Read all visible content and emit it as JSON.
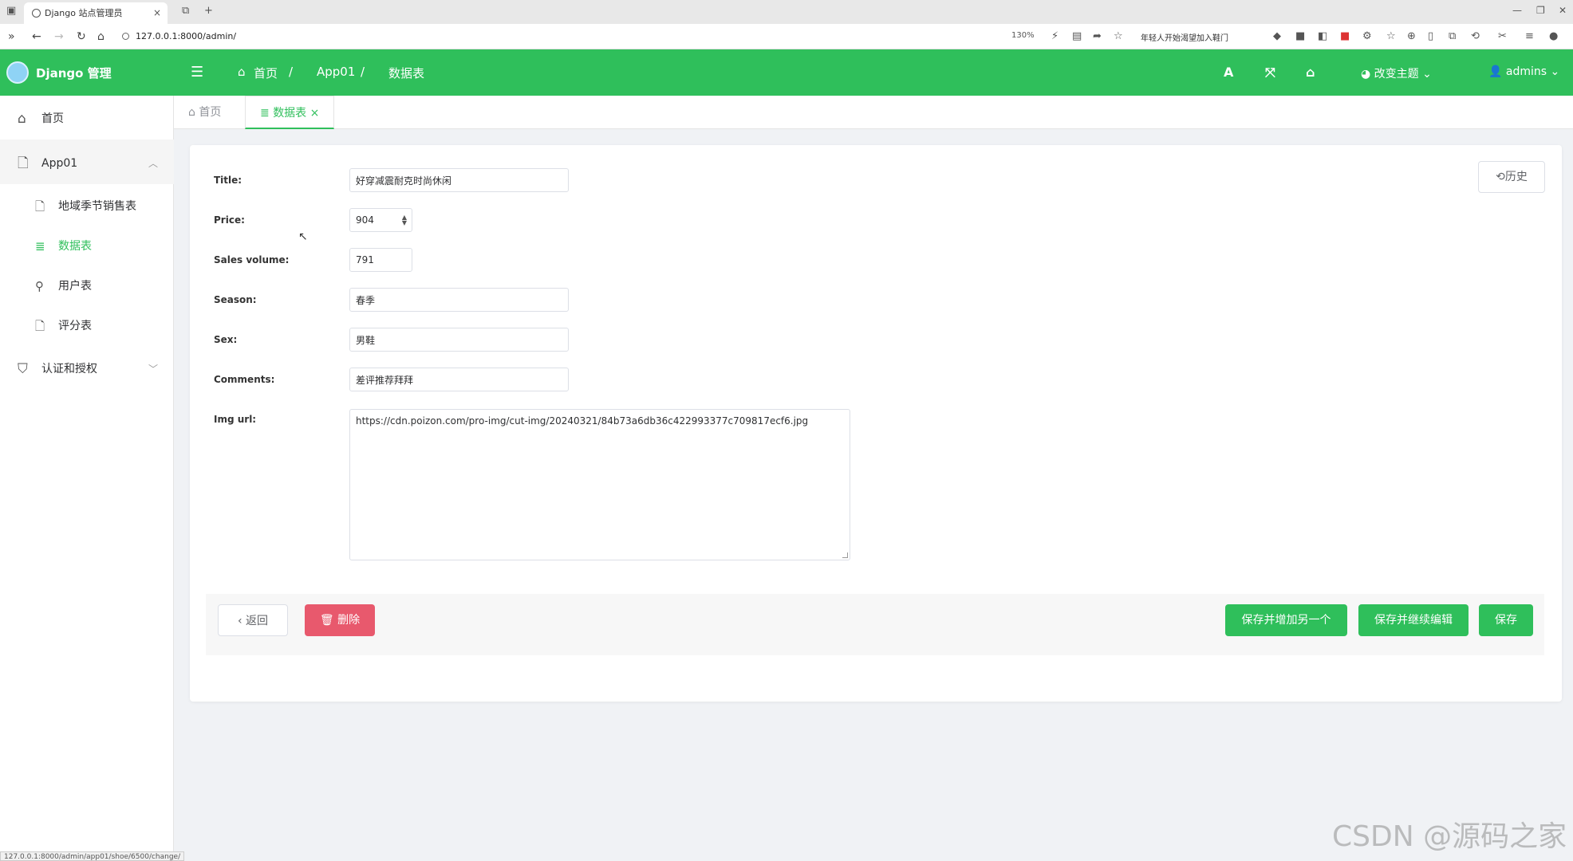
{
  "browser": {
    "tab_title": "Django 站点管理员",
    "tab_close": "×",
    "new_tab": "+",
    "url": "127.0.0.1:8000/admin/",
    "zoom": "130%",
    "ext_text": "年轻人开始渴望加入鞋门",
    "status_url": "127.0.0.1:8000/admin/app01/shoe/6500/change/"
  },
  "header": {
    "logo": "Django 管理",
    "breadcrumbs": [
      "首页",
      "App01",
      "数据表"
    ],
    "theme": "改变主题",
    "user": "admins"
  },
  "sidebar": {
    "items": [
      {
        "label": "首页"
      },
      {
        "label": "App01"
      },
      {
        "label": "地域季节销售表"
      },
      {
        "label": "数据表"
      },
      {
        "label": "用户表"
      },
      {
        "label": "评分表"
      },
      {
        "label": "认证和授权"
      }
    ]
  },
  "tabs": [
    {
      "label": "首页"
    },
    {
      "label": "数据表"
    }
  ],
  "form": {
    "history": "历史",
    "fields": {
      "title": {
        "label": "Title:",
        "value": "好穿减震耐克时尚休闲"
      },
      "price": {
        "label": "Price:",
        "value": "904"
      },
      "sales": {
        "label": "Sales volume:",
        "value": "791"
      },
      "season": {
        "label": "Season:",
        "value": "春季"
      },
      "sex": {
        "label": "Sex:",
        "value": "男鞋"
      },
      "comments": {
        "label": "Comments:",
        "value": "差评推荐拜拜"
      },
      "img_url": {
        "label": "Img url:",
        "value": "https://cdn.poizon.com/pro-img/cut-img/20240321/84b73a6db36c422993377c709817ecf6.jpg"
      }
    }
  },
  "actions": {
    "back": "返回",
    "delete": "删除",
    "save_add": "保存并增加另一个",
    "save_continue": "保存并继续编辑",
    "save": "保存"
  },
  "watermark": "CSDN @源码之家",
  "colors": {
    "brand": "#2fbf5b",
    "danger": "#e8596d"
  }
}
